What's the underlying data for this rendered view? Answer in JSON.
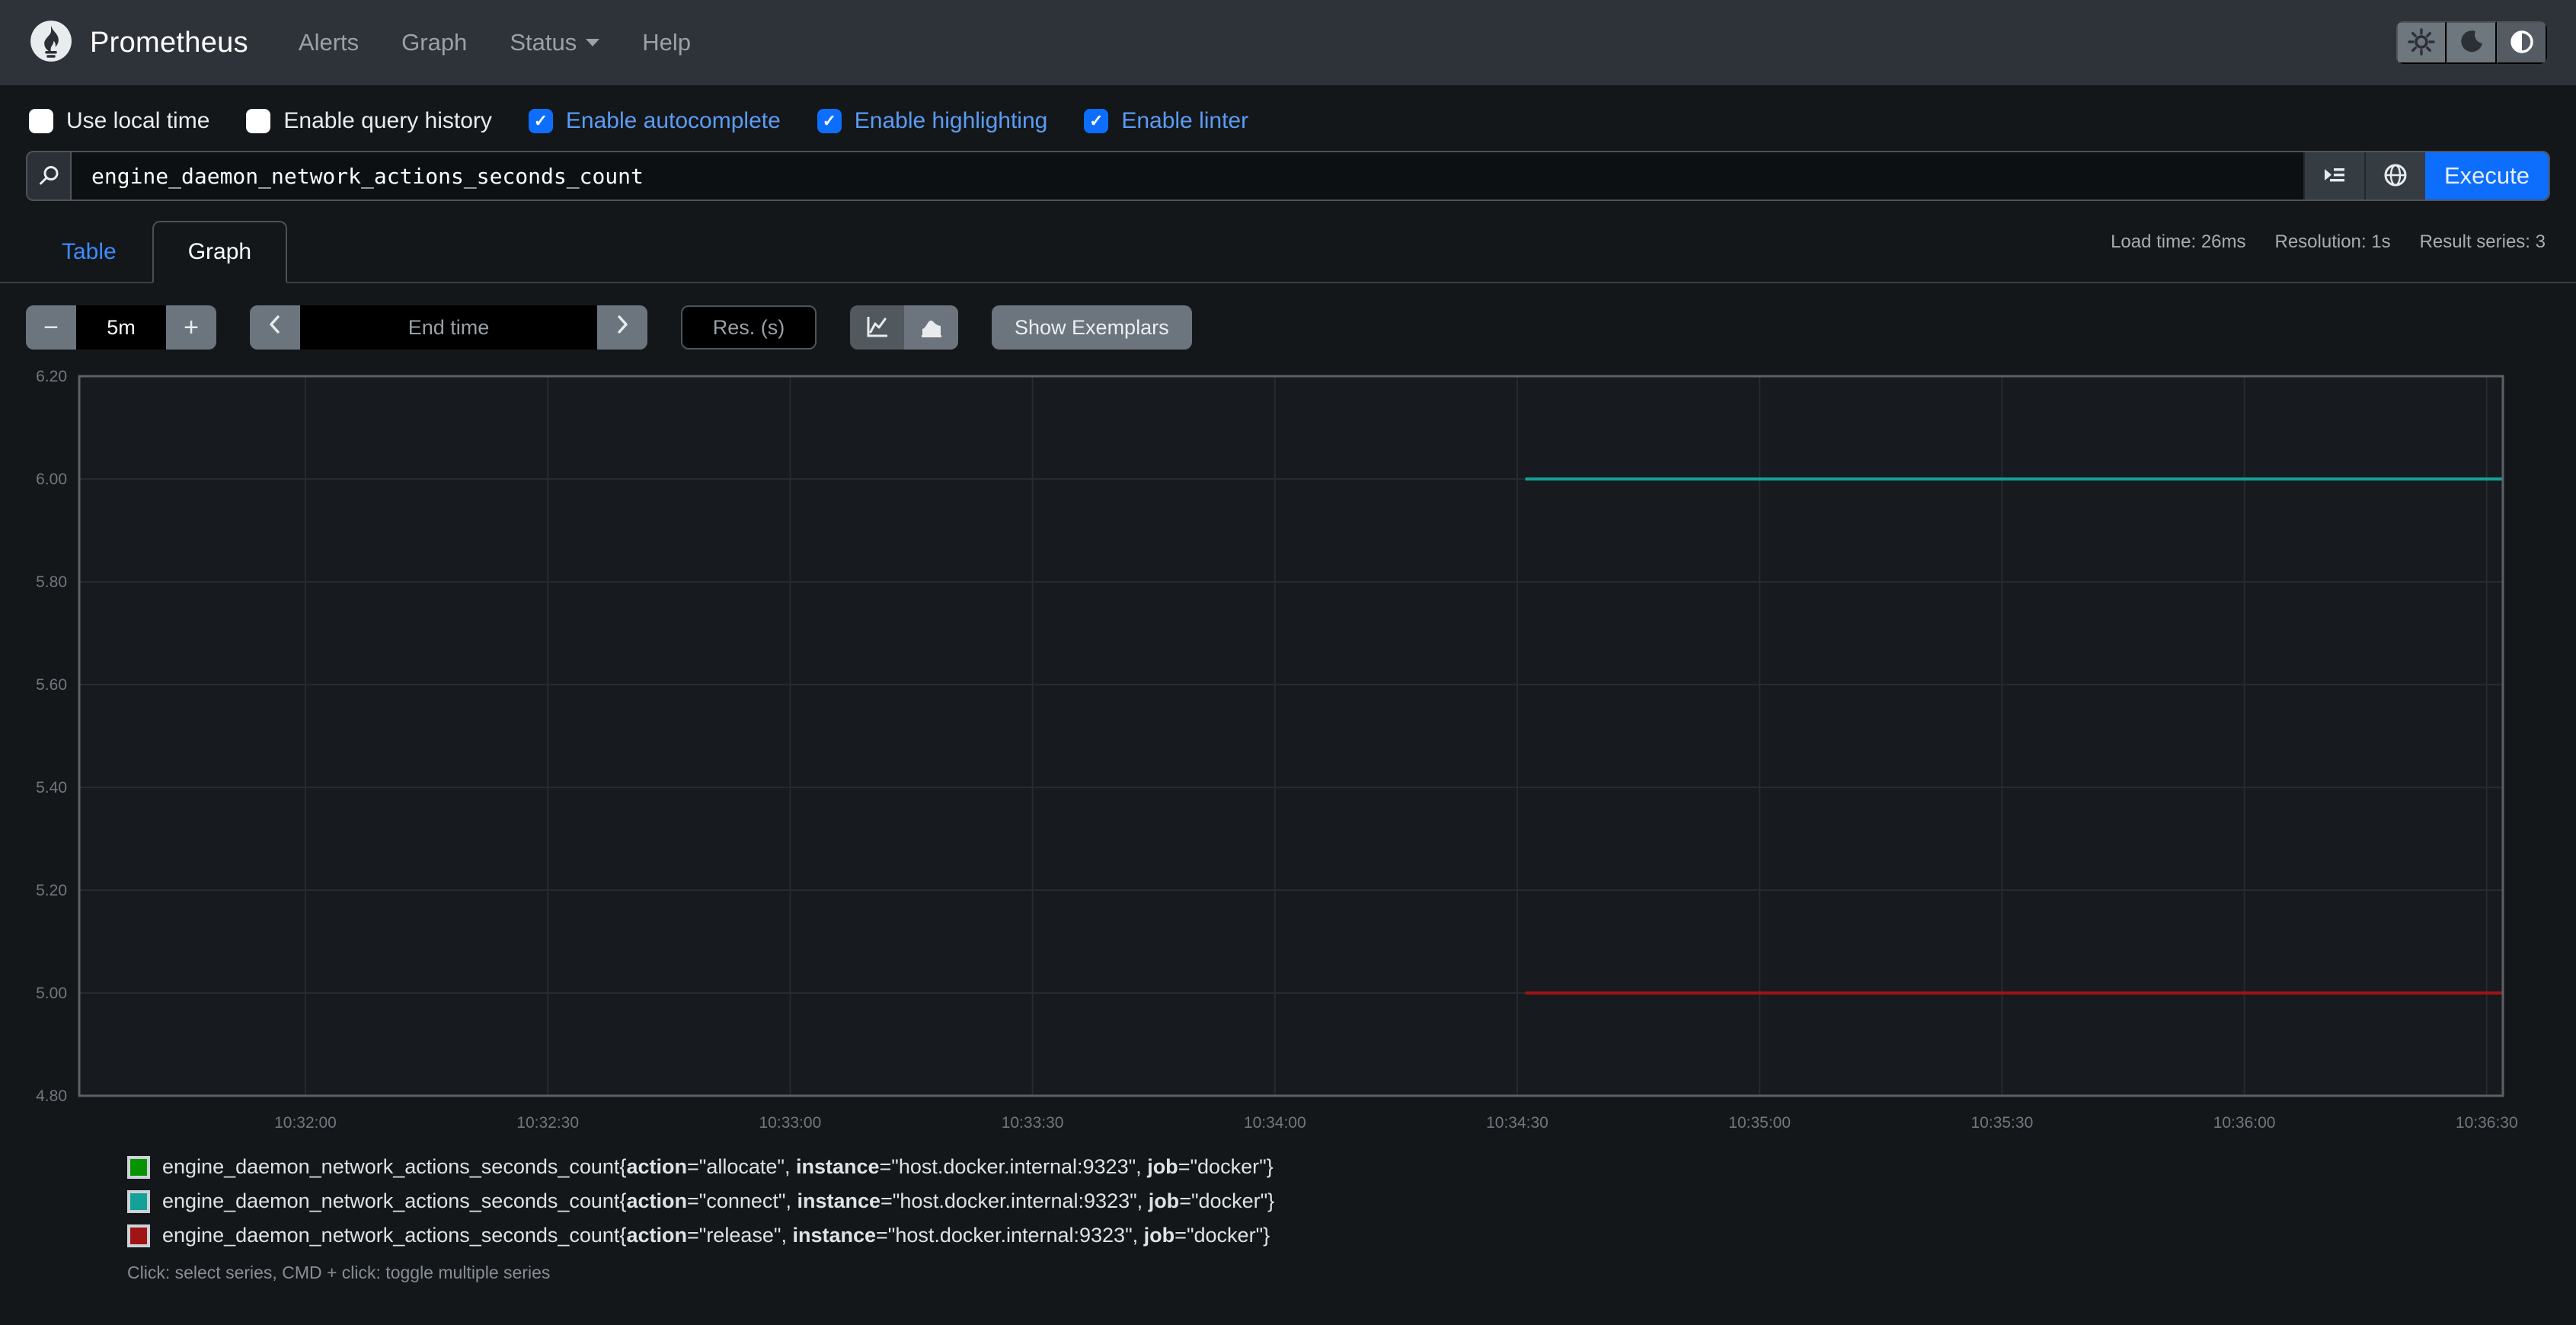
{
  "nav": {
    "brand": "Prometheus",
    "items": [
      "Alerts",
      "Graph",
      "Status",
      "Help"
    ]
  },
  "theme_toggle": {
    "icons": [
      "sun-icon",
      "moon-icon",
      "circle-half-icon"
    ],
    "active": "circle-half-icon"
  },
  "options": {
    "checkboxes": [
      {
        "label": "Use local time",
        "checked": false
      },
      {
        "label": "Enable query history",
        "checked": false
      },
      {
        "label": "Enable autocomplete",
        "checked": true
      },
      {
        "label": "Enable highlighting",
        "checked": true
      },
      {
        "label": "Enable linter",
        "checked": true
      }
    ]
  },
  "query": {
    "value": "engine_daemon_network_actions_seconds_count",
    "execute_label": "Execute"
  },
  "stats": {
    "load_time": "Load time: 26ms",
    "resolution": "Resolution: 1s",
    "result_series": "Result series: 3"
  },
  "tabs": [
    {
      "label": "Table",
      "active": false
    },
    {
      "label": "Graph",
      "active": true
    }
  ],
  "controls": {
    "range_value": "5m",
    "end_time_placeholder": "End time",
    "resolution_placeholder": "Res. (s)",
    "show_exemplars_label": "Show Exemplars"
  },
  "chart_data": {
    "type": "line",
    "grid": true,
    "legend_position": "bottom",
    "x_axis": {
      "domain_start": "10:31:32",
      "domain_end": "10:36:32",
      "ticks": [
        "10:32:00",
        "10:32:30",
        "10:33:00",
        "10:33:30",
        "10:34:00",
        "10:34:30",
        "10:35:00",
        "10:35:30",
        "10:36:00",
        "10:36:30"
      ]
    },
    "y_axis": {
      "min": 4.8,
      "max": 6.2,
      "step": 0.2,
      "ticks": [
        "4.80",
        "5.00",
        "5.20",
        "5.40",
        "5.60",
        "5.80",
        "6.00",
        "6.20"
      ]
    },
    "series": [
      {
        "metric": "engine_daemon_network_actions_seconds_count",
        "labels": {
          "action": "allocate",
          "instance": "host.docker.internal:9323",
          "job": "docker"
        },
        "color": "#089400",
        "value": 6.0,
        "start": "10:34:31",
        "end": "10:36:32"
      },
      {
        "metric": "engine_daemon_network_actions_seconds_count",
        "labels": {
          "action": "connect",
          "instance": "host.docker.internal:9323",
          "job": "docker"
        },
        "color": "#14a198",
        "value": 6.0,
        "start": "10:34:31",
        "end": "10:36:32"
      },
      {
        "metric": "engine_daemon_network_actions_seconds_count",
        "labels": {
          "action": "release",
          "instance": "host.docker.internal:9323",
          "job": "docker"
        },
        "color": "#a01414",
        "value": 5.0,
        "start": "10:34:31",
        "end": "10:36:32"
      }
    ]
  },
  "footer": {
    "hint": "Click: select series, CMD + click: toggle multiple series"
  },
  "colors": {
    "accent_blue": "#0d6efd",
    "nav_bg": "#2d3339",
    "page_bg": "#14171a",
    "grid_line": "#262b30",
    "plot_border": "#5b6167"
  }
}
